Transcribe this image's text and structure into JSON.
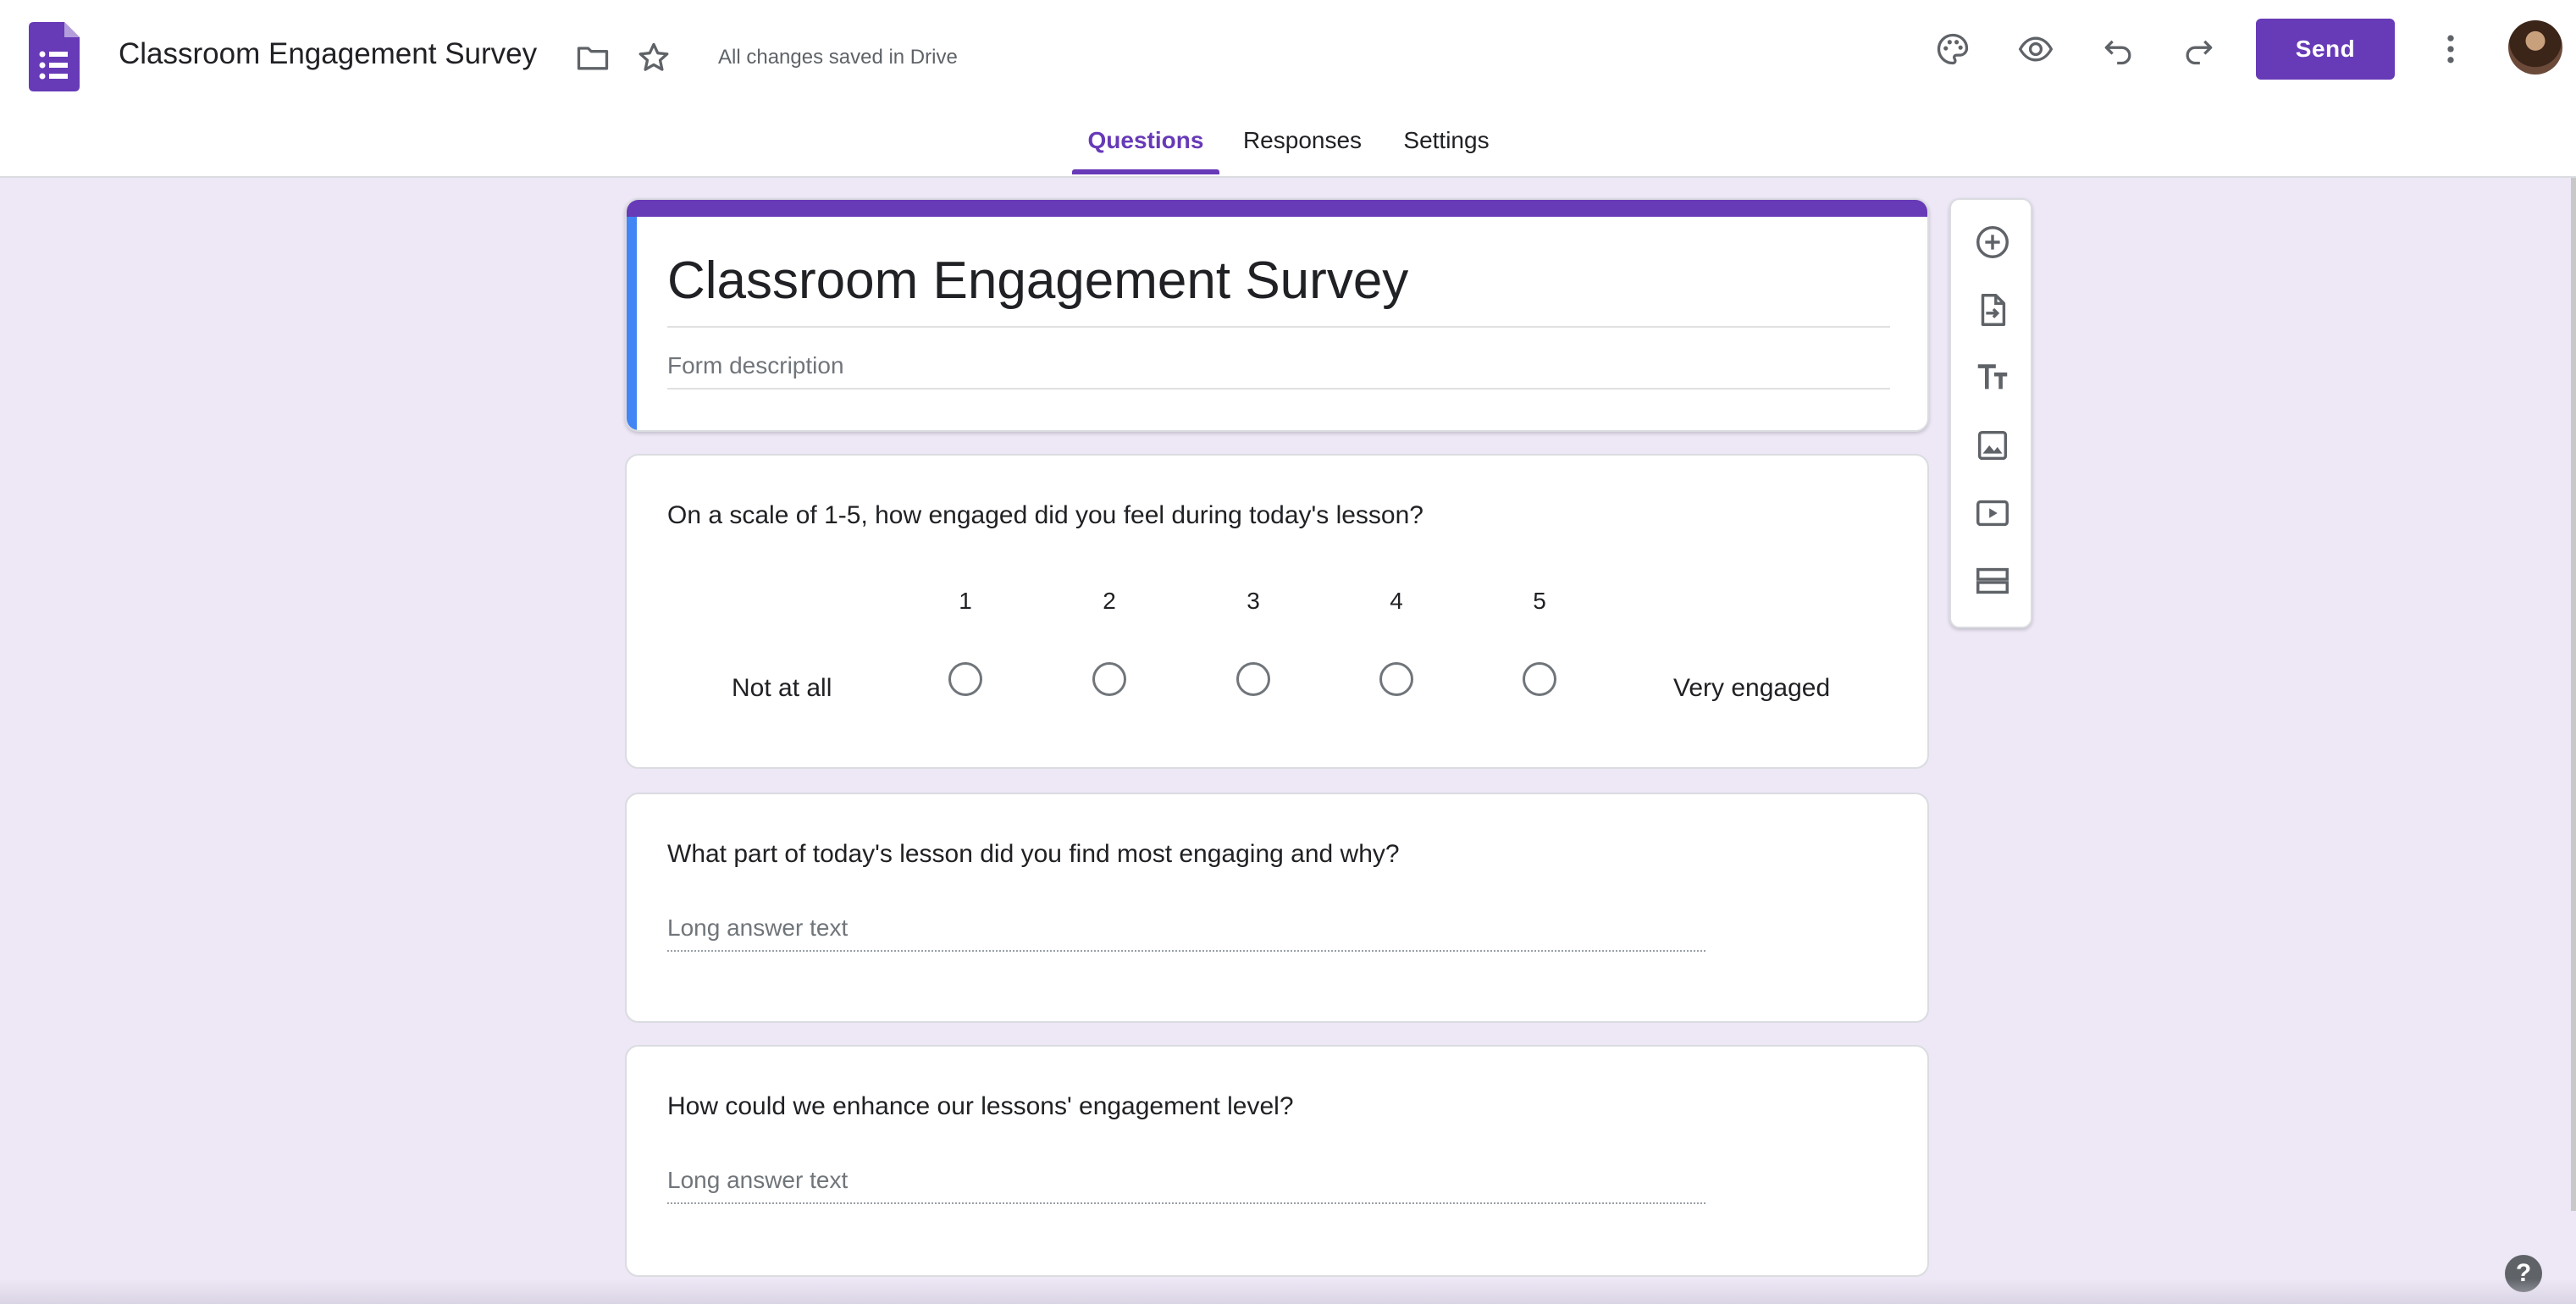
{
  "header": {
    "doc_title": "Classroom Engagement Survey",
    "save_status": "All changes saved in Drive",
    "send_label": "Send",
    "icons": [
      "forms-logo-icon",
      "folder-icon",
      "star-icon",
      "palette-icon",
      "preview-eye-icon",
      "undo-icon",
      "redo-icon",
      "more-vert-icon"
    ]
  },
  "tabs": [
    {
      "label": "Questions",
      "active": true
    },
    {
      "label": "Responses",
      "active": false
    },
    {
      "label": "Settings",
      "active": false
    }
  ],
  "form": {
    "title": "Classroom Engagement Survey",
    "description_placeholder": "Form description",
    "accent_color": "#673ab7",
    "focus_bar_color": "#4285f4"
  },
  "questions": [
    {
      "title": "On a scale of 1-5, how engaged did you feel during today's lesson?",
      "type": "linear-scale",
      "scale": [
        "1",
        "2",
        "3",
        "4",
        "5"
      ],
      "low_label": "Not at all",
      "high_label": "Very engaged"
    },
    {
      "title": "What part of today's lesson did you find most engaging and why?",
      "type": "paragraph",
      "placeholder": "Long answer text"
    },
    {
      "title": "How could we enhance our lessons' engagement level?",
      "type": "paragraph",
      "placeholder": "Long answer text"
    }
  ],
  "side_toolbar": [
    "add-question-icon",
    "import-questions-icon",
    "add-title-icon",
    "add-image-icon",
    "add-video-icon",
    "add-section-icon"
  ],
  "help": "?"
}
